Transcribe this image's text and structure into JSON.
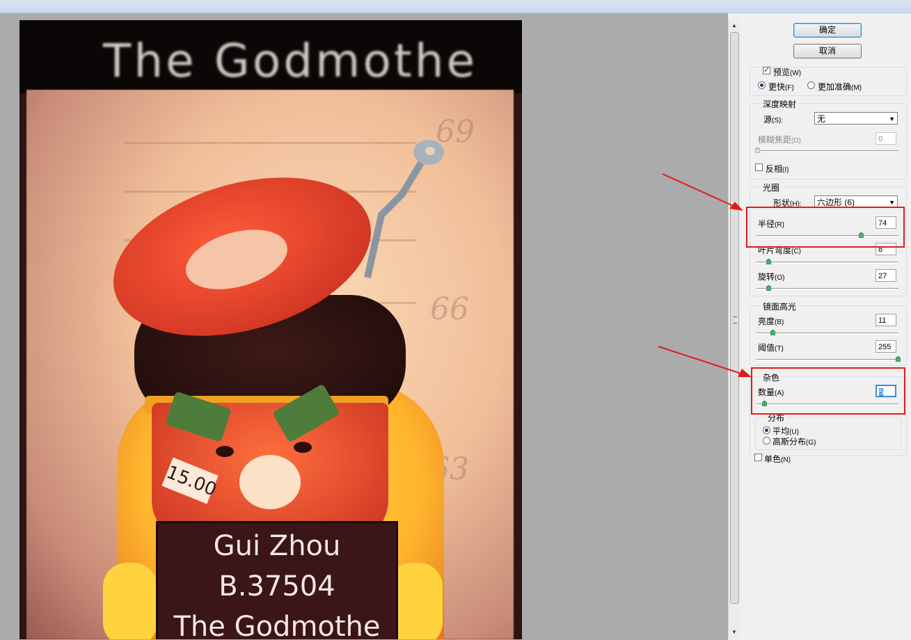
{
  "canvas": {
    "image_title_text": "The Godmothe",
    "price_tag": "15.00",
    "sign_lines": [
      "Gui Zhou",
      "B.37504",
      "The Godmothe"
    ],
    "poster_numbers": [
      "69",
      "66",
      "63"
    ]
  },
  "buttons": {
    "ok": "确定",
    "cancel": "取消"
  },
  "preview": {
    "label": "预览",
    "shortcut": "(W)",
    "checked": true
  },
  "speed": {
    "faster": {
      "label": "更快",
      "shortcut": "(F)",
      "selected": true
    },
    "accurate": {
      "label": "更加准确",
      "shortcut": "(M)",
      "selected": false
    }
  },
  "depth_map": {
    "title": "深度映射",
    "source_label": "源",
    "source_shortcut": "(S):",
    "source_value": "无",
    "blur_focal_label": "模糊焦距",
    "blur_focal_shortcut": "(D)",
    "blur_focal_value": "0",
    "invert_label": "反相",
    "invert_shortcut": "(I)"
  },
  "iris": {
    "title": "光圈",
    "shape_label": "形状",
    "shape_shortcut": "(H):",
    "shape_value": "六边形 (6)",
    "radius_label": "半径",
    "radius_shortcut": "(R)",
    "radius_value": "74",
    "curvature_label": "叶片弯度",
    "curvature_shortcut": "(C)",
    "curvature_value": "8",
    "rotation_label": "旋转",
    "rotation_shortcut": "(O)",
    "rotation_value": "27"
  },
  "specular": {
    "title": "镜面高光",
    "brightness_label": "亮度",
    "brightness_shortcut": "(B)",
    "brightness_value": "11",
    "threshold_label": "阈值",
    "threshold_shortcut": "(T)",
    "threshold_value": "255"
  },
  "noise": {
    "title": "杂色",
    "amount_label": "数量",
    "amount_shortcut": "(A)",
    "amount_value": "5",
    "distribution_title": "分布",
    "uniform_label": "平均",
    "uniform_shortcut": "(U)",
    "gaussian_label": "高斯分布",
    "gaussian_shortcut": "(G)",
    "monochrome_label": "单色",
    "monochrome_shortcut": "(N)"
  },
  "colors": {
    "annotation_red": "#e11b1b",
    "accent_blue": "#3a8ed6"
  }
}
